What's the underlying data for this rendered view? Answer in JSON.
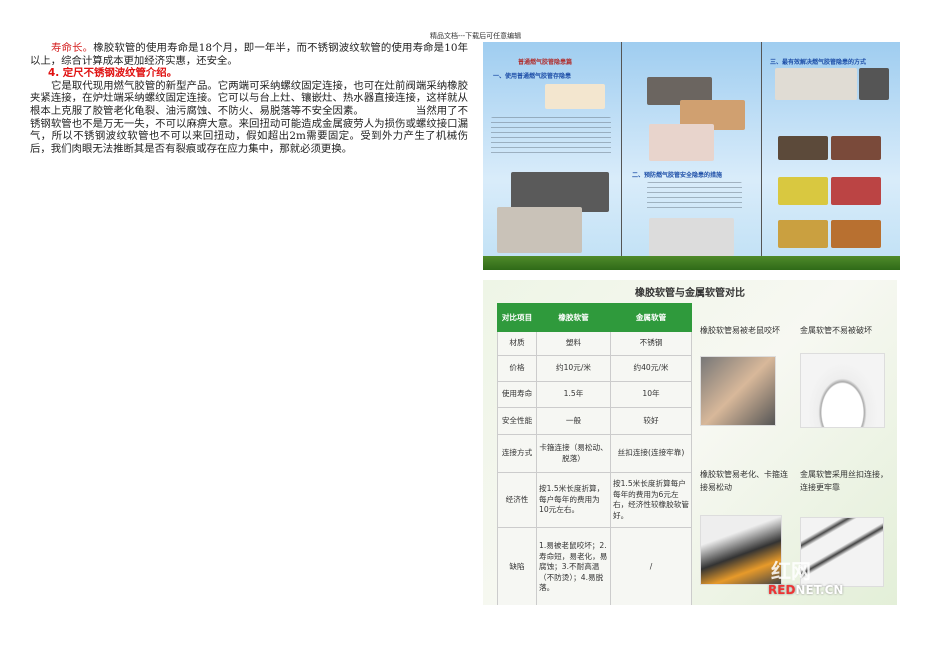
{
  "header": "精品文档---下载后可任意编辑",
  "text": {
    "p1_lead": "寿命长。",
    "p1": "橡胶软管的使用寿命是18个月，即一年半，而不锈钢波纹软管的使用寿命是10年以上，综合计算成本更加经济实惠，还安全。",
    "heading4": "4. 定尺不锈钢波纹管介绍。",
    "p2a": "它是取代现用燃气胶管的新型产品。它两端可采纳螺纹固定连接，也可在灶前阀端采纳橡胶夹紧连接，在炉灶端采纳螺纹固定连接。它可以与台上灶、镶嵌灶、热水器直接连接，这样就从根本上克服了胶管老化龟裂、油污腐蚀、不防火、易脱落等不安全因素。",
    "p2b": "当然用了不锈钢软管也不是万无一失，不可以麻痹大意。来回扭动可能造成金属疲劳人为损伤或螺纹接口漏气，所以不锈钢波纹软管也不可以来回扭动，假如超出2m需要固定。受到外力产生了机械伤后，我们肉眼无法推断其是否有裂痕或存在应力集中，那就必须更换。"
  },
  "brochure": {
    "title": "普通燃气胶管隐患篇",
    "s1": "一、使用普通燃气胶管存隐患",
    "s2": "二、预防燃气胶管安全隐患的措施",
    "s3": "三、最有效解决燃气胶管隐患的方式"
  },
  "comparison": {
    "title": "橡胶软管与金属软管对比",
    "headers": [
      "对比项目",
      "橡胶软管",
      "金属软管"
    ],
    "rows": [
      [
        "材质",
        "塑料",
        "不锈钢"
      ],
      [
        "价格",
        "约10元/米",
        "约40元/米"
      ],
      [
        "使用寿命",
        "1.5年",
        "10年"
      ],
      [
        "安全性能",
        "一般",
        "较好"
      ],
      [
        "连接方式",
        "卡箍连接（易松动、脱落）",
        "丝扣连接(连接牢靠)"
      ],
      [
        "经济性",
        "按1.5米长度折算，每户每年的费用为10元左右。",
        "按1.5米长度折算每户每年的费用为6元左右，经济性较橡胶软管好。"
      ],
      [
        "缺陷",
        "1.易被老鼠咬坏；2.寿命短，易老化，易腐蚀；3.不耐高温（不防烫）；4.易脱落。",
        "/"
      ]
    ],
    "captions": [
      "橡胶软管易被老鼠咬坏",
      "金属软管不易被破坏",
      "橡胶软管易老化、卡箍连接易松动",
      "金属软管采用丝扣连接，连接更牢靠"
    ],
    "watermark": "红网",
    "watermark_site_a": "RED",
    "watermark_site_b": "NET.CN"
  }
}
